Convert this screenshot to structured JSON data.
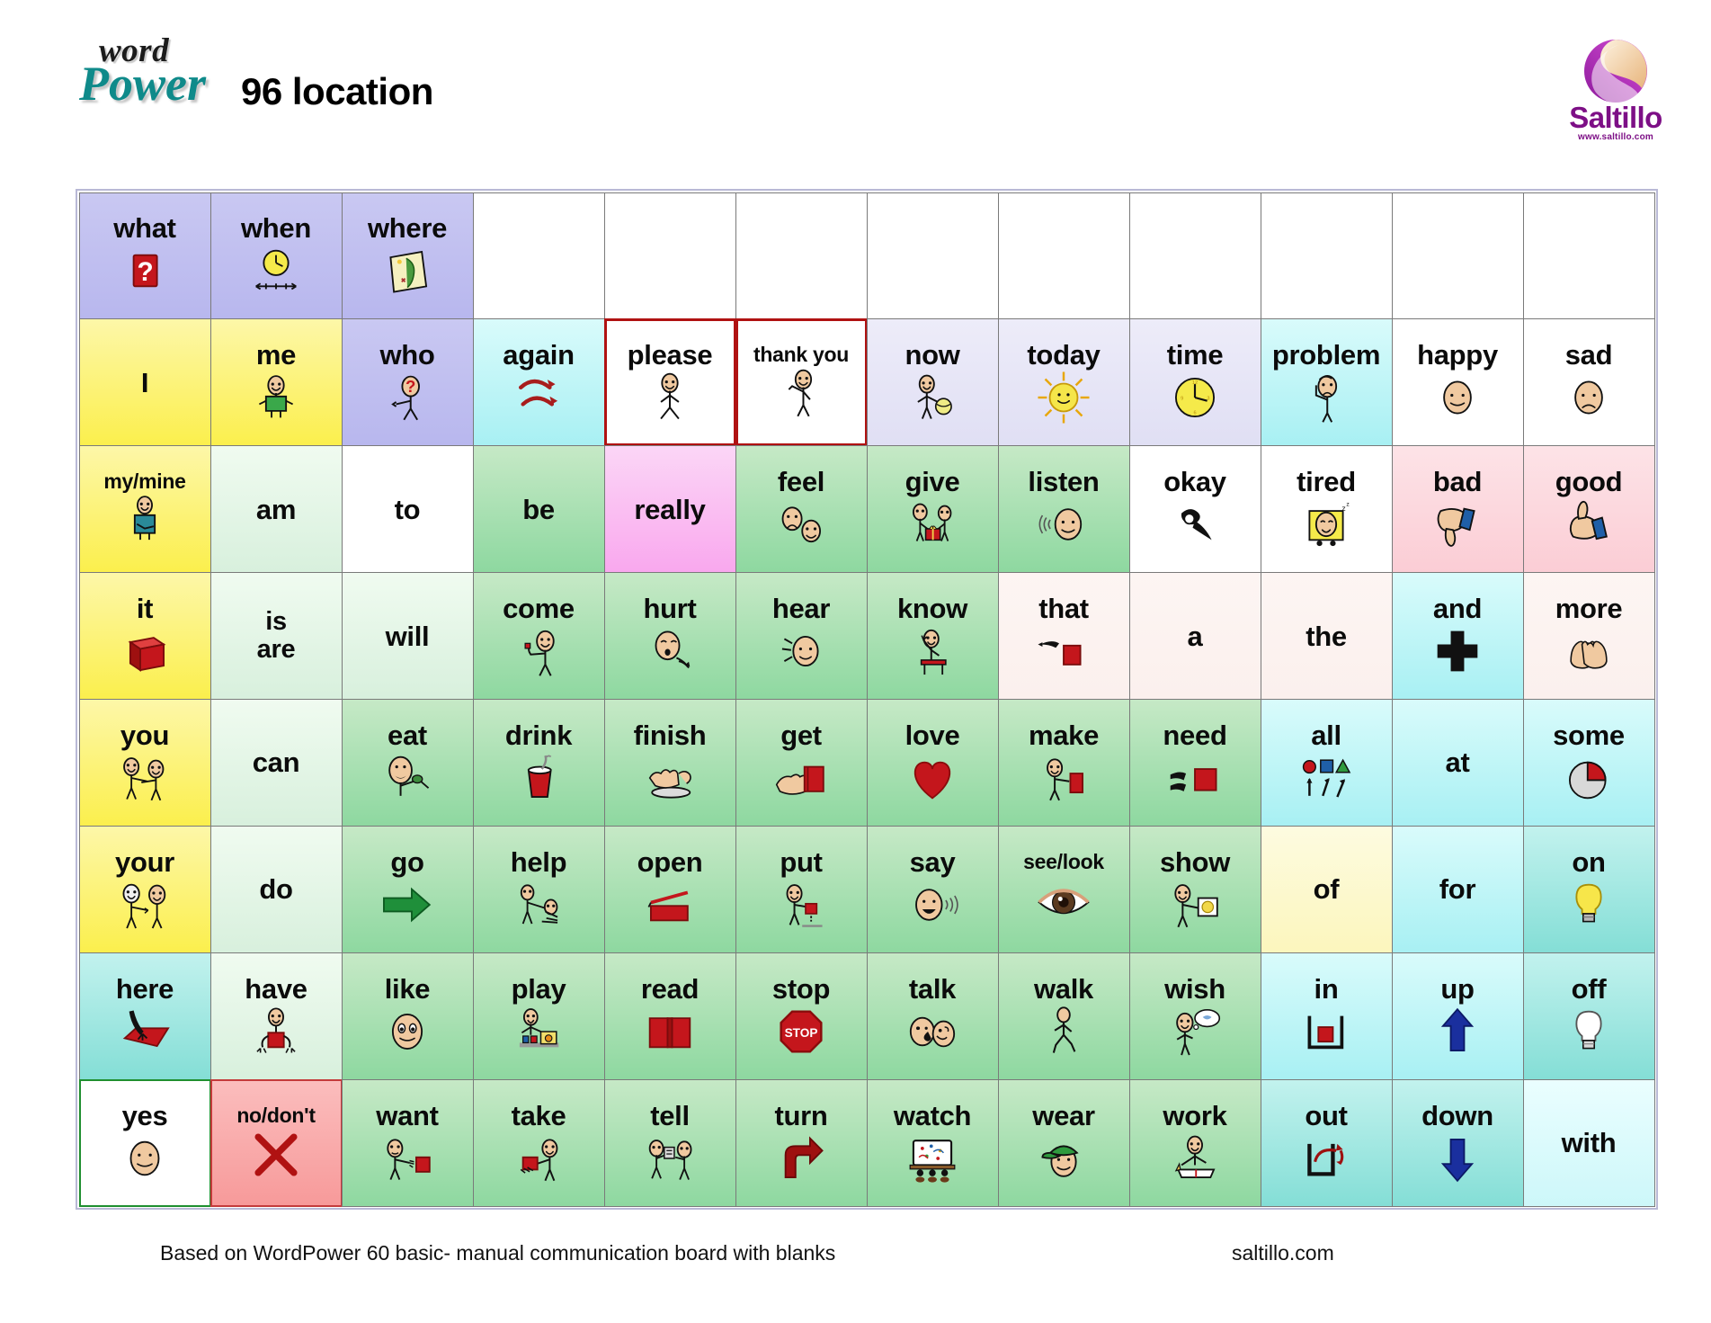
{
  "header": {
    "logo_word": "word",
    "logo_power": "Power",
    "title": "96 location",
    "brand_name": "Saltillo",
    "brand_url": "www.saltillo.com"
  },
  "footer": {
    "note": "Based on WordPower 60 basic- manual communication board with blanks",
    "site": "saltillo.com"
  },
  "board": {
    "columns": 12,
    "rows": 8,
    "palette": {
      "lavender": "#bdbcf0",
      "lavender_pale": "#e6e5f7",
      "yellow": "#fbef4d",
      "yellow_pale": "#fcf6bd",
      "green": "#8ed8a0",
      "green_pale": "#ddf3e0",
      "cyan": "#a8f0f3",
      "teal": "#84ded6",
      "pink": "#fbcdd5",
      "pink_hot": "#f9a8ee",
      "offwhite": "#fbf0ed",
      "white": "#ffffff",
      "salmon": "#f79a9a",
      "red_border": "#b01212",
      "green_border": "#1f8f2f"
    },
    "cells": [
      {
        "label": "what",
        "icon": "question-mark-red-square",
        "bg": "lav",
        "border": ""
      },
      {
        "label": "when",
        "icon": "clock-timeline",
        "bg": "lav",
        "border": ""
      },
      {
        "label": "where",
        "icon": "map-scroll",
        "bg": "lav",
        "border": ""
      },
      {
        "label": "",
        "icon": "",
        "bg": "white",
        "border": ""
      },
      {
        "label": "",
        "icon": "",
        "bg": "white",
        "border": ""
      },
      {
        "label": "",
        "icon": "",
        "bg": "white",
        "border": ""
      },
      {
        "label": "",
        "icon": "",
        "bg": "white",
        "border": ""
      },
      {
        "label": "",
        "icon": "",
        "bg": "white",
        "border": ""
      },
      {
        "label": "",
        "icon": "",
        "bg": "white",
        "border": ""
      },
      {
        "label": "",
        "icon": "",
        "bg": "white",
        "border": ""
      },
      {
        "label": "",
        "icon": "",
        "bg": "white",
        "border": ""
      },
      {
        "label": "",
        "icon": "",
        "bg": "white",
        "border": ""
      },
      {
        "label": "I",
        "icon": "",
        "bg": "yellow",
        "border": ""
      },
      {
        "label": "me",
        "icon": "person-green-shirt",
        "bg": "yellow",
        "border": ""
      },
      {
        "label": "who",
        "icon": "person-question-face",
        "bg": "lav",
        "border": ""
      },
      {
        "label": "again",
        "icon": "two-curved-arrows",
        "bg": "cyan",
        "border": ""
      },
      {
        "label": "please",
        "icon": "person-standing",
        "bg": "white",
        "border": "red"
      },
      {
        "label": "thank you",
        "icon": "person-waving",
        "bg": "white",
        "border": "red"
      },
      {
        "label": "now",
        "icon": "person-holding-ball",
        "bg": "lav-pale",
        "border": ""
      },
      {
        "label": "today",
        "icon": "sun",
        "bg": "lav-pale",
        "border": ""
      },
      {
        "label": "time",
        "icon": "clock",
        "bg": "lav-pale",
        "border": ""
      },
      {
        "label": "problem",
        "icon": "person-worried",
        "bg": "cyan",
        "border": ""
      },
      {
        "label": "happy",
        "icon": "face-happy",
        "bg": "white",
        "border": ""
      },
      {
        "label": "sad",
        "icon": "face-sad",
        "bg": "white",
        "border": ""
      },
      {
        "label": "my/mine",
        "icon": "person-pointing-self",
        "bg": "yellow",
        "border": ""
      },
      {
        "label": "am",
        "icon": "",
        "bg": "green-pale",
        "border": ""
      },
      {
        "label": "to",
        "icon": "",
        "bg": "white",
        "border": ""
      },
      {
        "label": "be",
        "icon": "",
        "bg": "green",
        "border": ""
      },
      {
        "label": "really",
        "icon": "",
        "bg": "pink-hot",
        "border": ""
      },
      {
        "label": "feel",
        "icon": "two-faces-sad-happy",
        "bg": "green",
        "border": ""
      },
      {
        "label": "give",
        "icon": "two-people-gift",
        "bg": "green",
        "border": ""
      },
      {
        "label": "listen",
        "icon": "face-listening",
        "bg": "green",
        "border": ""
      },
      {
        "label": "okay",
        "icon": "hand-ok",
        "bg": "white",
        "border": ""
      },
      {
        "label": "tired",
        "icon": "face-sleeping-blanket",
        "bg": "white",
        "border": ""
      },
      {
        "label": "bad",
        "icon": "thumbs-down",
        "bg": "pink",
        "border": ""
      },
      {
        "label": "good",
        "icon": "thumbs-up",
        "bg": "pink",
        "border": ""
      },
      {
        "label": "it",
        "icon": "red-cube",
        "bg": "yellow",
        "border": ""
      },
      {
        "label": "is\nare",
        "icon": "",
        "bg": "green-pale",
        "border": ""
      },
      {
        "label": "will",
        "icon": "",
        "bg": "green-pale",
        "border": ""
      },
      {
        "label": "come",
        "icon": "person-beckoning",
        "bg": "green",
        "border": ""
      },
      {
        "label": "hurt",
        "icon": "face-hurt",
        "bg": "green",
        "border": ""
      },
      {
        "label": "hear",
        "icon": "face-hearing",
        "bg": "green",
        "border": ""
      },
      {
        "label": "know",
        "icon": "person-raising-hand",
        "bg": "green",
        "border": ""
      },
      {
        "label": "that",
        "icon": "hand-pointing-red-square",
        "bg": "offwhite",
        "border": ""
      },
      {
        "label": "a",
        "icon": "",
        "bg": "offwhite",
        "border": ""
      },
      {
        "label": "the",
        "icon": "",
        "bg": "offwhite",
        "border": ""
      },
      {
        "label": "and",
        "icon": "plus-sign",
        "bg": "cyan",
        "border": ""
      },
      {
        "label": "more",
        "icon": "two-hands-together",
        "bg": "offwhite",
        "border": ""
      },
      {
        "label": "you",
        "icon": "two-people-pointing",
        "bg": "yellow",
        "border": ""
      },
      {
        "label": "can",
        "icon": "",
        "bg": "green-pale",
        "border": ""
      },
      {
        "label": "eat",
        "icon": "person-eating",
        "bg": "green",
        "border": ""
      },
      {
        "label": "drink",
        "icon": "cup-with-straw",
        "bg": "green",
        "border": ""
      },
      {
        "label": "finish",
        "icon": "hands-empty-plate",
        "bg": "green",
        "border": ""
      },
      {
        "label": "get",
        "icon": "hand-taking-book",
        "bg": "green",
        "border": ""
      },
      {
        "label": "love",
        "icon": "red-heart",
        "bg": "green",
        "border": ""
      },
      {
        "label": "make",
        "icon": "person-building",
        "bg": "green",
        "border": ""
      },
      {
        "label": "need",
        "icon": "hands-reaching-square",
        "bg": "green",
        "border": ""
      },
      {
        "label": "all",
        "icon": "shapes-with-arrows",
        "bg": "cyan",
        "border": ""
      },
      {
        "label": "at",
        "icon": "",
        "bg": "cyan",
        "border": ""
      },
      {
        "label": "some",
        "icon": "pie-chart-slice",
        "bg": "cyan",
        "border": ""
      },
      {
        "label": "your",
        "icon": "person-pointing-other",
        "bg": "yellow",
        "border": ""
      },
      {
        "label": "do",
        "icon": "",
        "bg": "green-pale",
        "border": ""
      },
      {
        "label": "go",
        "icon": "green-arrow-right",
        "bg": "green",
        "border": ""
      },
      {
        "label": "help",
        "icon": "person-helping-person",
        "bg": "green",
        "border": ""
      },
      {
        "label": "open",
        "icon": "opening-box",
        "bg": "green",
        "border": ""
      },
      {
        "label": "put",
        "icon": "person-placing-object",
        "bg": "green",
        "border": ""
      },
      {
        "label": "say",
        "icon": "face-speaking",
        "bg": "green",
        "border": ""
      },
      {
        "label": "see/look",
        "icon": "eye",
        "bg": "green",
        "border": ""
      },
      {
        "label": "show",
        "icon": "person-showing-picture",
        "bg": "green",
        "border": ""
      },
      {
        "label": "of",
        "icon": "",
        "bg": "yellow-pale",
        "border": ""
      },
      {
        "label": "for",
        "icon": "",
        "bg": "cyan",
        "border": ""
      },
      {
        "label": "on",
        "icon": "lightbulb-on",
        "bg": "teal",
        "border": ""
      },
      {
        "label": "here",
        "icon": "hand-pointing-down-mat",
        "bg": "teal",
        "border": ""
      },
      {
        "label": "have",
        "icon": "person-holding-box",
        "bg": "green-pale",
        "border": ""
      },
      {
        "label": "like",
        "icon": "face-smiling-big-eyes",
        "bg": "green",
        "border": ""
      },
      {
        "label": "play",
        "icon": "person-with-toys",
        "bg": "green",
        "border": ""
      },
      {
        "label": "read",
        "icon": "open-book-red",
        "bg": "green",
        "border": ""
      },
      {
        "label": "stop",
        "icon": "stop-sign",
        "bg": "green",
        "border": ""
      },
      {
        "label": "talk",
        "icon": "two-faces-talking",
        "bg": "green",
        "border": ""
      },
      {
        "label": "walk",
        "icon": "person-walking",
        "bg": "green",
        "border": ""
      },
      {
        "label": "wish",
        "icon": "person-thinking-bubble",
        "bg": "green",
        "border": ""
      },
      {
        "label": "in",
        "icon": "square-into-container",
        "bg": "cyan",
        "border": ""
      },
      {
        "label": "up",
        "icon": "blue-arrow-up",
        "bg": "cyan",
        "border": ""
      },
      {
        "label": "off",
        "icon": "lightbulb-off",
        "bg": "teal",
        "border": ""
      },
      {
        "label": "yes",
        "icon": "face-smiling",
        "bg": "white",
        "border": "green"
      },
      {
        "label": "no/don't",
        "icon": "red-x",
        "bg": "salmon",
        "border": "pinkred"
      },
      {
        "label": "want",
        "icon": "person-reaching-object",
        "bg": "green",
        "border": ""
      },
      {
        "label": "take",
        "icon": "person-taking-object",
        "bg": "green",
        "border": ""
      },
      {
        "label": "tell",
        "icon": "person-telling-person",
        "bg": "green",
        "border": ""
      },
      {
        "label": "turn",
        "icon": "arrow-turn-right",
        "bg": "green",
        "border": ""
      },
      {
        "label": "watch",
        "icon": "people-watching-screen",
        "bg": "green",
        "border": ""
      },
      {
        "label": "wear",
        "icon": "face-with-cap",
        "bg": "green",
        "border": ""
      },
      {
        "label": "work",
        "icon": "person-at-desk",
        "bg": "green",
        "border": ""
      },
      {
        "label": "out",
        "icon": "arrow-out-of-container",
        "bg": "teal",
        "border": ""
      },
      {
        "label": "down",
        "icon": "blue-arrow-down",
        "bg": "teal",
        "border": ""
      },
      {
        "label": "with",
        "icon": "",
        "bg": "cyan-pale",
        "border": ""
      }
    ]
  }
}
